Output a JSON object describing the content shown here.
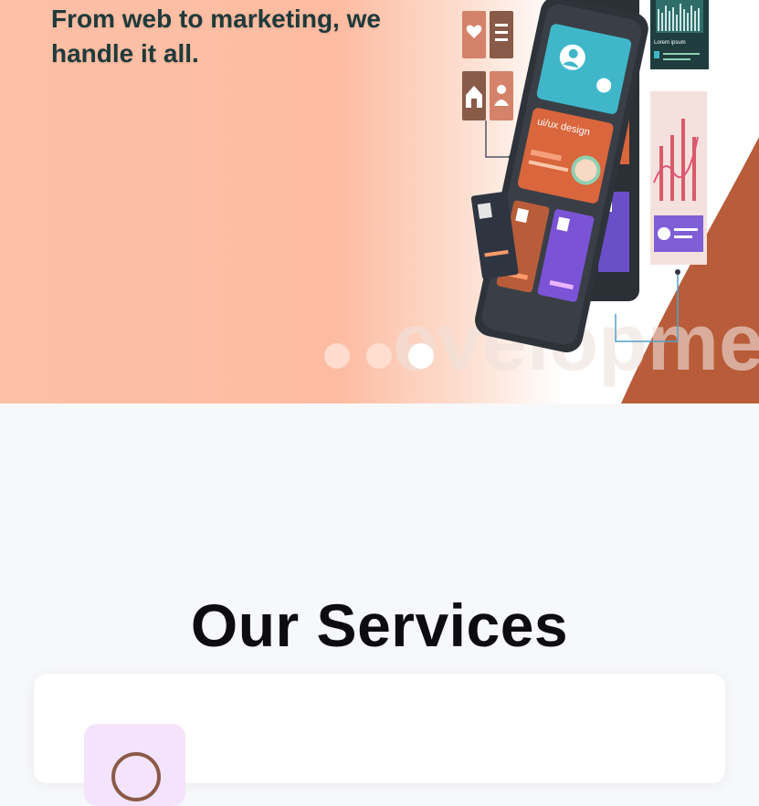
{
  "hero": {
    "tagline_lines": [
      "From web to marketing, we",
      "handle it all."
    ],
    "slides": [
      {
        "label": "slide-1",
        "active": false
      },
      {
        "label": "slide-2",
        "active": false
      },
      {
        "label": "slide-3",
        "active": true
      }
    ],
    "illustration": {
      "design_label": "ui/ux design",
      "faded_watermark": "evelopment",
      "panel_caption": "Lorem ipsum"
    }
  },
  "services": {
    "title": "Our Services"
  },
  "colors": {
    "accent": "#b85c3a",
    "hero_peach": "#fcc0a6",
    "heading": "#1f3a3a",
    "icon_bg": "#f3e4fb"
  }
}
